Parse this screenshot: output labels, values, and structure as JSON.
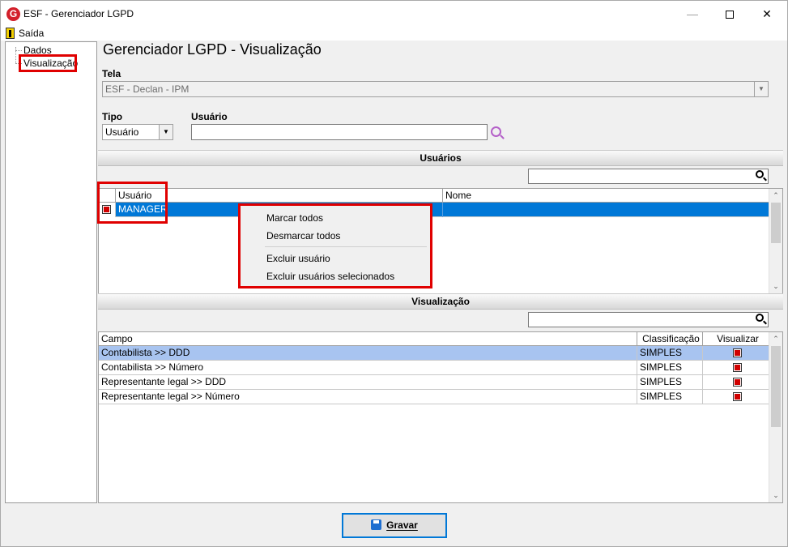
{
  "window": {
    "title": "ESF - Gerenciador LGPD",
    "logo_letter": "G"
  },
  "menu": {
    "exit_label": "Saída"
  },
  "tree": {
    "items": [
      {
        "label": "Dados"
      },
      {
        "label": "Visualização"
      }
    ]
  },
  "page": {
    "title": "Gerenciador LGPD - Visualização"
  },
  "screen_field": {
    "label": "Tela",
    "value": "ESF - Declan - IPM"
  },
  "type_field": {
    "label": "Tipo",
    "value": "Usuário"
  },
  "user_field": {
    "label": "Usuário",
    "value": ""
  },
  "users_section": {
    "title": "Usuários",
    "search_value": "",
    "columns": [
      "Usuário",
      "Nome"
    ],
    "rows": [
      {
        "checked": true,
        "usuario": "MANAGER",
        "nome": ""
      }
    ]
  },
  "context_menu": {
    "items": [
      "Marcar todos",
      "Desmarcar todos",
      "Excluir usuário",
      "Excluir usuários selecionados"
    ]
  },
  "view_section": {
    "title": "Visualização",
    "search_value": "",
    "columns": [
      "Campo",
      "Classificação",
      "Visualizar"
    ],
    "rows": [
      {
        "campo": "Contabilista >> DDD",
        "classificacao": "SIMPLES",
        "visualizar": true
      },
      {
        "campo": "Contabilista >> Número",
        "classificacao": "SIMPLES",
        "visualizar": true
      },
      {
        "campo": "Representante legal >> DDD",
        "classificacao": "SIMPLES",
        "visualizar": true
      },
      {
        "campo": "Representante legal >> Número",
        "classificacao": "SIMPLES",
        "visualizar": true
      }
    ]
  },
  "footer": {
    "save_label": "Gravar"
  },
  "colors": {
    "selection": "#0078d7",
    "row_highlight": "#a8c4f0",
    "highlight_box": "#e00000"
  }
}
